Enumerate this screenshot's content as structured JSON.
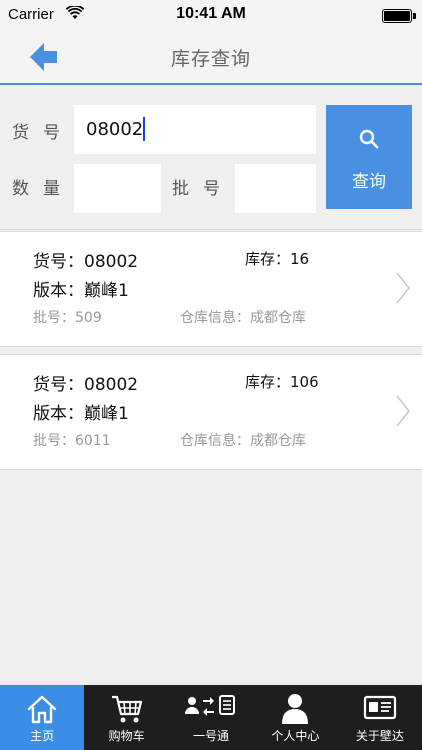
{
  "status_bar": {
    "carrier": "Carrier",
    "time": "10:41 AM"
  },
  "nav": {
    "title": "库存查询",
    "back_icon": "back-arrow-icon"
  },
  "search": {
    "huohao_label": "货号",
    "huohao_value": "08002",
    "shuliang_label": "数量",
    "shuliang_value": "",
    "pihao_label": "批号",
    "pihao_value": "",
    "button_label": "查询",
    "button_icon": "search-icon"
  },
  "results": [
    {
      "code": "货号：08002",
      "stock": "库存：16",
      "version": "版本：巅峰1",
      "batch": "批号：509",
      "warehouse": "仓库信息：成都仓库"
    },
    {
      "code": "货号：08002",
      "stock": "库存：106",
      "version": "版本：巅峰1",
      "batch": "批号：6011",
      "warehouse": "仓库信息：成都仓库"
    }
  ],
  "tabs": [
    {
      "label": "主页",
      "icon": "home-icon",
      "active": true
    },
    {
      "label": "购物车",
      "icon": "cart-icon",
      "active": false
    },
    {
      "label": "一号通",
      "icon": "transfer-icon",
      "active": false
    },
    {
      "label": "个人中心",
      "icon": "person-icon",
      "active": false
    },
    {
      "label": "关于壁达",
      "icon": "id-card-icon",
      "active": false
    }
  ],
  "colors": {
    "accent": "#4a90e2",
    "tab_bar_bg": "#1e1e1e",
    "active_tab": "#3b8ee8"
  }
}
